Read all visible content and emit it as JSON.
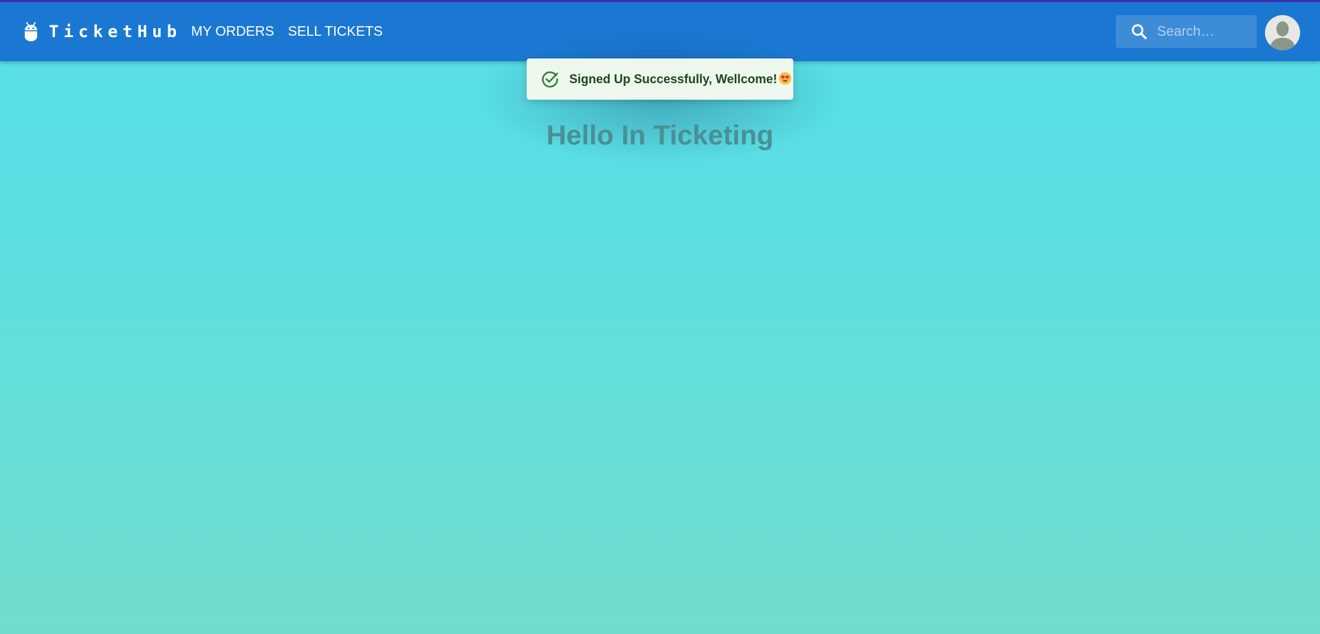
{
  "header": {
    "brand": {
      "name": "TicketHub",
      "icon": "android-icon"
    },
    "nav": [
      "MY ORDERS",
      "SELL TICKETS"
    ],
    "search": {
      "placeholder": "Search…",
      "value": "",
      "icon": "search-icon"
    },
    "avatar": {
      "icon": "person-avatar-icon"
    }
  },
  "toast": {
    "message": "Signed Up Successfully, Wellcome!",
    "icon": "check-circle-icon",
    "emoji": "heart-eyes-emoji-icon",
    "severity": "success"
  },
  "main": {
    "title": "Hello In Ticketing"
  },
  "colors": {
    "appbar": "#1b78d2",
    "top_line": "#3f2fb8",
    "background_top": "#55dfe8",
    "background_bottom": "#70ddcc",
    "toast_bg": "#edf7ed",
    "toast_text": "#1e4620",
    "toast_icon": "#2e7d32",
    "title_text": "#4a8f96"
  }
}
